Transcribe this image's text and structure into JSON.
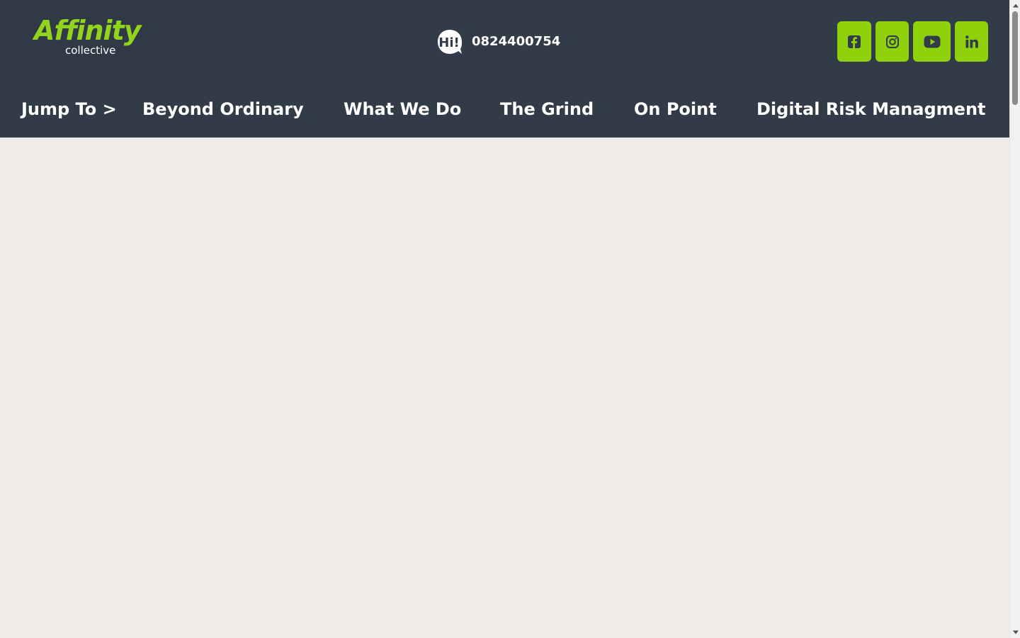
{
  "brand": {
    "name": "Affinity",
    "subtitle": "collective",
    "accent": "#91d31d"
  },
  "contact": {
    "icon": "hi-speech-bubble-icon",
    "icon_text": "Hi!",
    "phone": "0824400754"
  },
  "social": [
    {
      "name": "facebook-icon"
    },
    {
      "name": "instagram-icon"
    },
    {
      "name": "youtube-icon"
    },
    {
      "name": "linkedin-icon"
    }
  ],
  "nav": {
    "jump_label": "Jump To >",
    "items": [
      {
        "label": "Beyond Ordinary"
      },
      {
        "label": "What We Do"
      },
      {
        "label": "The Grind"
      },
      {
        "label": "On Point"
      },
      {
        "label": "Digital Risk Managment"
      }
    ]
  },
  "colors": {
    "header_bg": "#313c48",
    "page_bg": "#efebe8",
    "button_green": "#8fd20c"
  }
}
